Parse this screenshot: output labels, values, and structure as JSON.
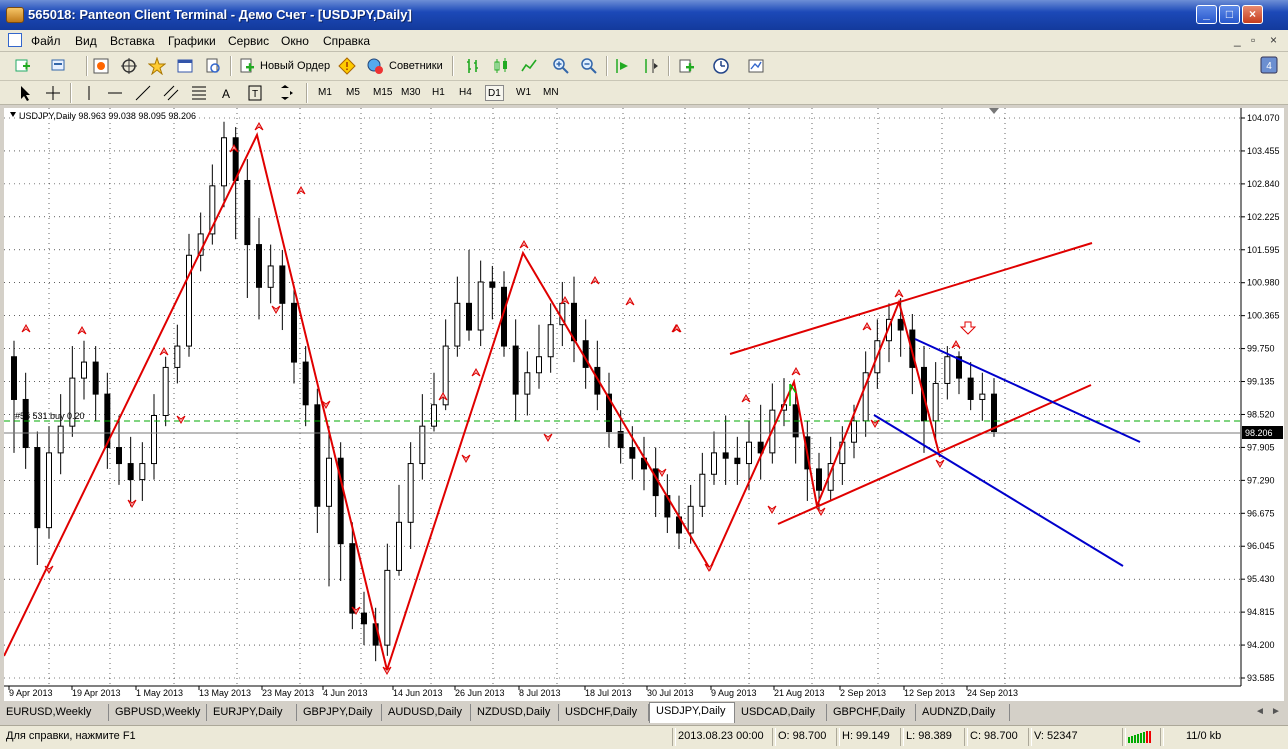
{
  "window": {
    "title": "565018: Panteon Client Terminal - Демо Счет - [USDJPY,Daily]",
    "btn_minimize": "_",
    "btn_maximize": "□",
    "btn_close": "×"
  },
  "menu": {
    "items": [
      "Файл",
      "Вид",
      "Вставка",
      "Графики",
      "Сервис",
      "Окно",
      "Справка"
    ],
    "mdi_minimize": "_",
    "mdi_restore": "▫",
    "mdi_close": "×"
  },
  "toolbar": {
    "new_order": "Новый Ордер",
    "experts": "Советники",
    "tool_text": "A"
  },
  "timeframes": [
    "M1",
    "M5",
    "M15",
    "M30",
    "H1",
    "H4",
    "D1",
    "W1",
    "MN"
  ],
  "active_timeframe": "D1",
  "chart": {
    "header": "USDJPY,Daily  98.963 99.038 98.095 98.206",
    "order_label": "#55 531 buy 0.20",
    "current_price_label": "98.206",
    "price_ticks": [
      "104.070",
      "103.455",
      "102.840",
      "102.225",
      "101.595",
      "100.980",
      "100.365",
      "99.750",
      "99.135",
      "98.520",
      "97.905",
      "97.290",
      "96.675",
      "96.045",
      "95.430",
      "94.815",
      "94.200",
      "93.585"
    ],
    "date_ticks": [
      "9 Apr 2013",
      "19 Apr 2013",
      "1 May 2013",
      "13 May 2013",
      "23 May 2013",
      "4 Jun 2013",
      "14 Jun 2013",
      "26 Jun 2013",
      "8 Jul 2013",
      "18 Jul 2013",
      "30 Jul 2013",
      "9 Aug 2013",
      "21 Aug 2013",
      "2 Sep 2013",
      "12 Sep 2013",
      "24 Sep 2013"
    ],
    "colors": {
      "zigzag": "#e00000",
      "channel_up": "#e00000",
      "channel_down": "#0000cc",
      "order_line": "#00aa00",
      "candle": "#000000"
    }
  },
  "chart_data": {
    "type": "candlestick",
    "title": "USDJPY,Daily",
    "ylim": [
      93.585,
      104.07
    ],
    "candles": [
      [
        99.6,
        98.8,
        99.9,
        97.8
      ],
      [
        98.8,
        97.9,
        99.3,
        97.5
      ],
      [
        97.9,
        96.4,
        98.2,
        95.7
      ],
      [
        96.4,
        97.8,
        98.3,
        96.2
      ],
      [
        97.8,
        98.3,
        98.9,
        97.4
      ],
      [
        98.3,
        99.2,
        99.8,
        98.1
      ],
      [
        99.2,
        99.5,
        99.9,
        98.8
      ],
      [
        99.5,
        98.9,
        99.8,
        98.4
      ],
      [
        98.9,
        97.9,
        99.3,
        97.5
      ],
      [
        97.9,
        97.6,
        98.5,
        97.2
      ],
      [
        97.6,
        97.3,
        98.1,
        96.8
      ],
      [
        97.3,
        97.6,
        98.0,
        96.9
      ],
      [
        97.6,
        98.5,
        98.9,
        97.3
      ],
      [
        98.5,
        99.4,
        99.6,
        98.3
      ],
      [
        99.4,
        99.8,
        100.2,
        99.1
      ],
      [
        99.8,
        101.5,
        101.9,
        99.6
      ],
      [
        101.5,
        101.9,
        102.3,
        101.2
      ],
      [
        101.9,
        102.8,
        103.2,
        101.7
      ],
      [
        102.8,
        103.7,
        104.0,
        102.4
      ],
      [
        103.7,
        102.9,
        103.9,
        101.8
      ],
      [
        102.9,
        101.7,
        103.3,
        100.7
      ],
      [
        101.7,
        100.9,
        102.2,
        100.3
      ],
      [
        100.9,
        101.3,
        101.7,
        100.6
      ],
      [
        101.3,
        100.6,
        101.6,
        100.1
      ],
      [
        100.6,
        99.5,
        100.9,
        99.1
      ],
      [
        99.5,
        98.7,
        99.8,
        98.3
      ],
      [
        98.7,
        96.8,
        99.0,
        96.3
      ],
      [
        96.8,
        97.7,
        98.3,
        95.3
      ],
      [
        97.7,
        96.1,
        98.0,
        95.4
      ],
      [
        96.1,
        94.8,
        96.5,
        94.5
      ],
      [
        94.8,
        94.6,
        95.2,
        94.2
      ],
      [
        94.6,
        94.2,
        94.9,
        93.9
      ],
      [
        94.2,
        95.6,
        96.1,
        94.0
      ],
      [
        95.6,
        96.5,
        97.2,
        95.5
      ],
      [
        96.5,
        97.6,
        98.0,
        96.0
      ],
      [
        97.6,
        98.3,
        98.9,
        97.3
      ],
      [
        98.3,
        98.7,
        99.3,
        98.2
      ],
      [
        98.7,
        99.8,
        100.3,
        98.6
      ],
      [
        99.8,
        100.6,
        101.1,
        99.6
      ],
      [
        100.6,
        100.1,
        101.6,
        99.9
      ],
      [
        100.1,
        101.0,
        101.4,
        99.8
      ],
      [
        101.0,
        100.9,
        101.3,
        100.3
      ],
      [
        100.9,
        99.8,
        101.2,
        99.6
      ],
      [
        99.8,
        98.9,
        100.3,
        98.4
      ],
      [
        98.9,
        99.3,
        99.7,
        98.5
      ],
      [
        99.3,
        99.6,
        100.2,
        99.0
      ],
      [
        99.6,
        100.2,
        100.6,
        99.3
      ],
      [
        100.2,
        100.6,
        101.0,
        99.8
      ],
      [
        100.6,
        99.9,
        101.1,
        99.5
      ],
      [
        99.9,
        99.4,
        100.3,
        99.0
      ],
      [
        99.4,
        98.9,
        99.9,
        98.6
      ],
      [
        98.9,
        98.2,
        99.3,
        97.9
      ],
      [
        98.2,
        97.9,
        98.6,
        97.6
      ],
      [
        97.9,
        97.7,
        98.3,
        97.3
      ],
      [
        97.7,
        97.5,
        98.1,
        97.1
      ],
      [
        97.5,
        97.0,
        97.9,
        96.6
      ],
      [
        97.0,
        96.6,
        97.4,
        96.3
      ],
      [
        96.6,
        96.3,
        97.0,
        96.0
      ],
      [
        96.3,
        96.8,
        97.2,
        96.1
      ],
      [
        96.8,
        97.4,
        97.8,
        96.6
      ],
      [
        97.4,
        97.8,
        98.2,
        97.2
      ],
      [
        97.8,
        97.7,
        98.5,
        97.2
      ],
      [
        97.7,
        97.6,
        98.1,
        97.2
      ],
      [
        97.6,
        98.0,
        98.4,
        97.1
      ],
      [
        98.0,
        97.8,
        98.7,
        97.3
      ],
      [
        97.8,
        98.6,
        99.1,
        97.6
      ],
      [
        98.6,
        98.7,
        99.2,
        98.3
      ],
      [
        98.7,
        98.1,
        99.0,
        97.6
      ],
      [
        98.1,
        97.5,
        98.4,
        96.9
      ],
      [
        97.5,
        97.1,
        97.8,
        96.7
      ],
      [
        97.1,
        97.6,
        98.1,
        96.9
      ],
      [
        97.6,
        98.0,
        98.3,
        97.2
      ],
      [
        98.0,
        98.4,
        98.7,
        97.7
      ],
      [
        98.4,
        99.3,
        99.7,
        98.1
      ],
      [
        99.3,
        99.9,
        100.3,
        99.0
      ],
      [
        99.9,
        100.3,
        100.6,
        99.5
      ],
      [
        100.3,
        100.1,
        100.7,
        99.6
      ],
      [
        100.1,
        99.4,
        100.4,
        98.9
      ],
      [
        99.4,
        98.4,
        99.8,
        97.8
      ],
      [
        98.4,
        99.1,
        99.5,
        98.0
      ],
      [
        99.1,
        99.6,
        99.8,
        98.8
      ],
      [
        99.6,
        99.2,
        99.7,
        98.9
      ],
      [
        99.2,
        98.8,
        99.5,
        98.6
      ],
      [
        98.8,
        98.9,
        99.3,
        98.4
      ],
      [
        98.9,
        98.2,
        99.2,
        98.1
      ]
    ]
  }
}
